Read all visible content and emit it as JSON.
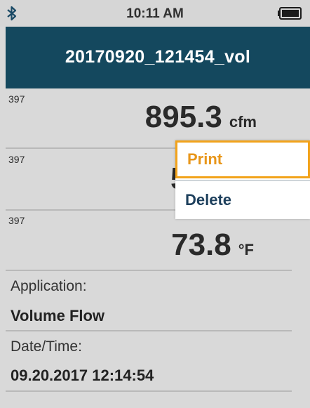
{
  "status": {
    "time": "10:11 AM",
    "bluetooth_icon": "bluetooth-icon",
    "battery_icon": "battery-full-icon"
  },
  "header": {
    "title": "20170920_121454_vol",
    "background_color": "#14485e"
  },
  "readings": [
    {
      "index": "397",
      "value": "895.3",
      "unit": "cfm"
    },
    {
      "index": "397",
      "value": "59",
      "unit": ""
    },
    {
      "index": "397",
      "value": "73.8",
      "unit": "°F"
    }
  ],
  "info": {
    "application_label": "Application:",
    "application_value": "Volume Flow",
    "datetime_label": "Date/Time:",
    "datetime_value": "09.20.2017 12:14:54"
  },
  "menu": {
    "items": [
      {
        "label": "Print",
        "selected": true
      },
      {
        "label": "Delete",
        "selected": false
      }
    ],
    "highlight_color": "#f2a31b"
  }
}
